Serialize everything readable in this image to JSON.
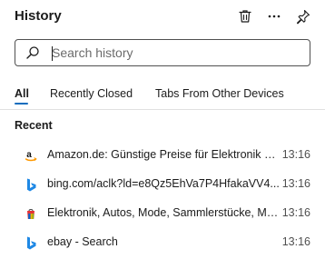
{
  "header": {
    "title": "History",
    "delete_icon": "trash-icon",
    "more_icon": "more-horizontal-icon",
    "pin_icon": "pin-icon"
  },
  "search": {
    "placeholder": "Search history",
    "value": "",
    "icon": "search-icon"
  },
  "tabs": [
    {
      "label": "All",
      "active": true
    },
    {
      "label": "Recently Closed",
      "active": false
    },
    {
      "label": "Tabs From Other Devices",
      "active": false
    }
  ],
  "sections": [
    {
      "title": "Recent",
      "items": [
        {
          "title": "Amazon.de: Günstige Preise für Elektronik & Foto, Filme, Musik, Bücher, Games, Spielzeug & mehr",
          "time": "13:16",
          "icon": "amazon-favicon"
        },
        {
          "title": "bing.com/aclk?ld=e8Qz5EhVa7P4HfakaVV4...",
          "time": "13:16",
          "icon": "bing-favicon"
        },
        {
          "title": "Elektronik, Autos, Mode, Sammlerstücke, Möbel und mehr | eBay",
          "time": "13:16",
          "icon": "ebay-favicon"
        },
        {
          "title": "ebay - Search",
          "time": "13:16",
          "icon": "bing-favicon"
        }
      ]
    }
  ],
  "colors": {
    "accent": "#0f6cbd",
    "bing_blue": "#1e88e5",
    "text": "#1b1b1b",
    "muted": "#505050"
  }
}
